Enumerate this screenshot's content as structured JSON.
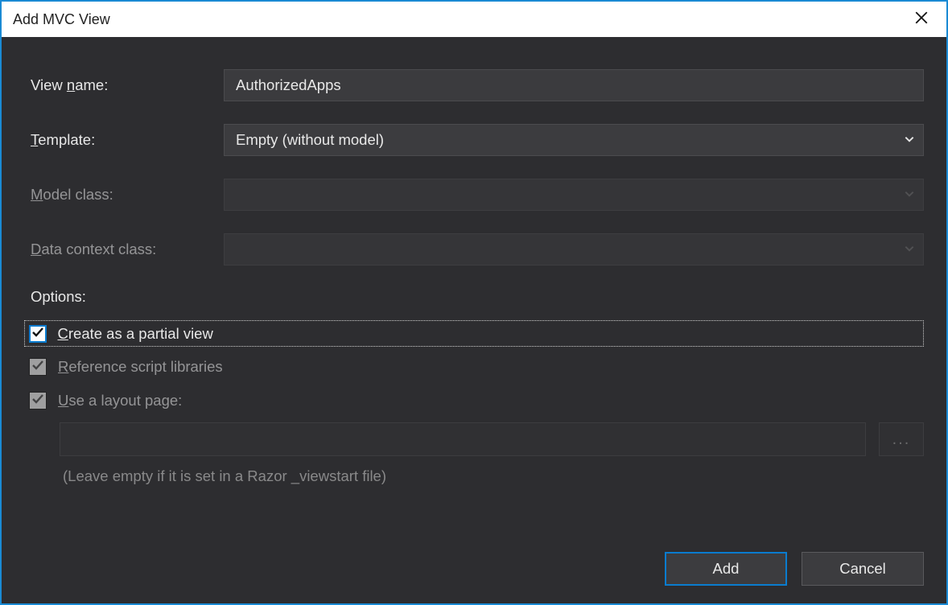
{
  "window": {
    "title": "Add MVC View"
  },
  "fields": {
    "view_name": {
      "label_pre": "View ",
      "label_mn": "n",
      "label_post": "ame:",
      "value": "AuthorizedApps"
    },
    "template": {
      "label_mn": "T",
      "label_post": "emplate:",
      "value": "Empty (without model)"
    },
    "model": {
      "label_mn": "M",
      "label_post": "odel class:",
      "value": ""
    },
    "datactx": {
      "label_mn": "D",
      "label_post": "ata context class:",
      "value": ""
    }
  },
  "options": {
    "heading": "Options:",
    "partial": {
      "label_mn": "C",
      "label_post": "reate as a partial view",
      "checked": true,
      "enabled": true,
      "focused": true
    },
    "scripts": {
      "label_mn": "R",
      "label_post": "eference script libraries",
      "checked": true,
      "enabled": false
    },
    "layout": {
      "label_mn": "U",
      "label_post": "se a layout page:",
      "checked": true,
      "enabled": false
    }
  },
  "layout_page": {
    "value": "",
    "browse": "...",
    "hint": "(Leave empty if it is set in a Razor _viewstart file)"
  },
  "buttons": {
    "ok": "Add",
    "cancel": "Cancel"
  }
}
